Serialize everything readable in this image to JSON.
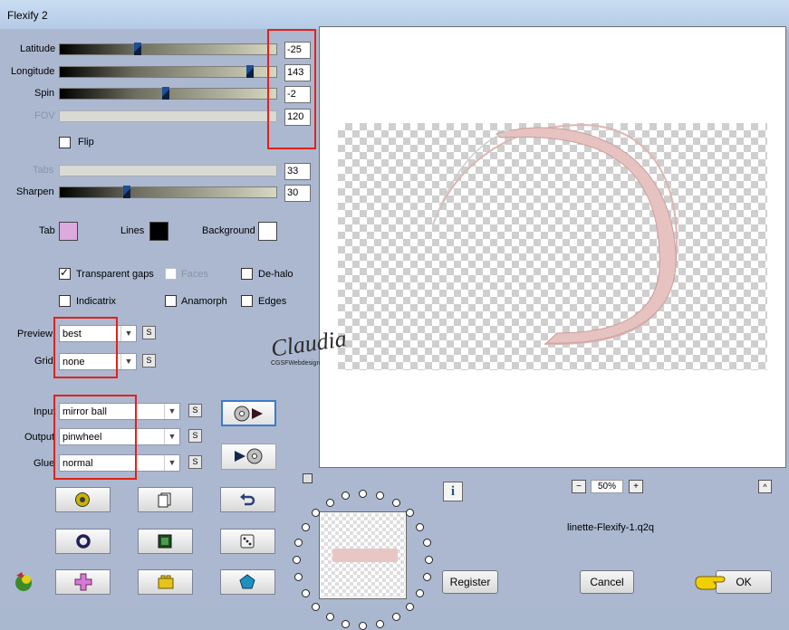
{
  "window": {
    "title": "Flexify 2"
  },
  "sliders": {
    "latitude": {
      "label": "Latitude",
      "value": "-25",
      "level": 0.36
    },
    "longitude": {
      "label": "Longitude",
      "value": "143",
      "level": 0.88
    },
    "spin": {
      "label": "Spin",
      "value": "-2",
      "level": 0.49
    },
    "fov": {
      "label": "FOV",
      "value": "120"
    },
    "tabs": {
      "label": "Tabs",
      "value": "33"
    },
    "sharpen": {
      "label": "Sharpen",
      "value": "30",
      "level": 0.31
    }
  },
  "flip": {
    "label": "Flip",
    "checked": false
  },
  "colors": {
    "tab": {
      "label": "Tab",
      "color": "#dcaadc"
    },
    "lines": {
      "label": "Lines",
      "color": "#000000"
    },
    "background": {
      "label": "Background",
      "color": "#ffffff"
    }
  },
  "options": {
    "transparent_gaps": {
      "label": "Transparent gaps",
      "checked": true
    },
    "faces": {
      "label": "Faces",
      "checked": false
    },
    "de_halo": {
      "label": "De-halo",
      "checked": false
    },
    "indicatrix": {
      "label": "Indicatrix",
      "checked": false
    },
    "anamorph": {
      "label": "Anamorph",
      "checked": false
    },
    "edges": {
      "label": "Edges",
      "checked": false
    }
  },
  "preview_select": {
    "label": "Preview",
    "value": "best"
  },
  "grid_select": {
    "label": "Grid",
    "value": "none"
  },
  "input_select": {
    "label": "Input",
    "value": "mirror ball"
  },
  "output_select": {
    "label": "Output",
    "value": "pinwheel"
  },
  "glue_select": {
    "label": "Glue",
    "value": "normal"
  },
  "s_button_label": "S",
  "zoom": {
    "value": "50%",
    "minus": "−",
    "plus": "+"
  },
  "preset_name": "linette-Flexify-1.q2q",
  "watermark": {
    "name": "Claudia",
    "sub": "CGSFWebdesign"
  },
  "buttons": {
    "register": "Register",
    "cancel": "Cancel",
    "ok": "OK",
    "info": "i",
    "collapse": "^"
  },
  "icons": {
    "render_to_preview": "disk-play-icon",
    "play_to_disk": "play-disk-icon",
    "randomize": "gold-ball-icon",
    "copy": "copy-pages-icon",
    "undo": "undo-arrow-icon",
    "ring": "ring-icon",
    "frame": "green-square-icon",
    "dice": "dice-icon",
    "cross": "pink-cross-icon",
    "lego": "yellow-brick-icon",
    "pentagon": "blue-pentagon-icon",
    "plugin": "flexify-logo-icon",
    "pointer": "pointing-hand-icon"
  }
}
